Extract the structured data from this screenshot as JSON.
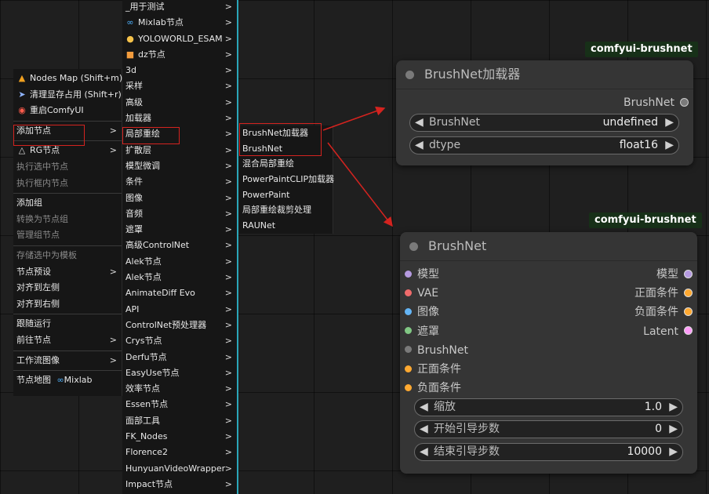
{
  "context_menu": {
    "items": [
      {
        "label": "Nodes Map (Shift+m)",
        "icon": "nodes-map-icon",
        "disabled": false,
        "submenu": false
      },
      {
        "label": "清理显存占用 (Shift+r)",
        "icon": "rocket-icon",
        "disabled": false,
        "submenu": false
      },
      {
        "label": "重启ComfyUI",
        "icon": "restart-icon",
        "disabled": false,
        "submenu": false
      },
      {
        "label": "添加节点",
        "disabled": false,
        "submenu": true
      },
      {
        "label": "RG节点",
        "icon": "rg-icon",
        "disabled": false,
        "submenu": true
      },
      {
        "label": "执行选中节点",
        "disabled": true,
        "submenu": false
      },
      {
        "label": "执行框内节点",
        "disabled": true,
        "submenu": false
      },
      {
        "label": "添加组",
        "disabled": false,
        "submenu": false
      },
      {
        "label": "转换为节点组",
        "disabled": true,
        "submenu": false
      },
      {
        "label": "管理组节点",
        "disabled": true,
        "submenu": false
      },
      {
        "label": "存储选中为模板",
        "disabled": true,
        "submenu": false
      },
      {
        "label": "节点预设",
        "disabled": false,
        "submenu": true
      },
      {
        "label": "对齐到左侧",
        "disabled": false,
        "submenu": false
      },
      {
        "label": "对齐到右侧",
        "disabled": false,
        "submenu": false
      },
      {
        "label": "跟随运行",
        "disabled": false,
        "submenu": false
      },
      {
        "label": "前往节点",
        "disabled": false,
        "submenu": true
      },
      {
        "label": "工作流图像",
        "disabled": false,
        "submenu": true
      },
      {
        "label": "节点地图",
        "suffix": "Mixlab",
        "disabled": false,
        "submenu": false
      }
    ]
  },
  "add_node_menu": {
    "items": [
      "_用于测试",
      "Mixlab节点",
      "YOLOWORLD_ESAM",
      "dz节点",
      "3d",
      "采样",
      "高级",
      "加载器",
      "局部重绘",
      "扩散层",
      "模型微调",
      "条件",
      "图像",
      "音频",
      "遮罩",
      "高级ControlNet",
      "Alek节点",
      "Alek节点",
      "AnimateDiff Evo",
      "API",
      "ControlNet预处理器",
      "Crys节点",
      "Derfu节点",
      "EasyUse节点",
      "效率节点",
      "Essen节点",
      "面部工具",
      "FK_Nodes",
      "Florence2",
      "HunyuanVideoWrapper",
      "Impact节点"
    ]
  },
  "inpaint_menu": {
    "items": [
      "BrushNet加载器",
      "BrushNet",
      "混合局部重绘",
      "PowerPaintCLIP加载器",
      "PowerPaint",
      "局部重绘裁剪处理",
      "RAUNet"
    ]
  },
  "loader_node": {
    "badge": "comfyui-brushnet",
    "title": "BrushNet加载器",
    "output": "BrushNet",
    "widgets": [
      {
        "label": "BrushNet",
        "value": "undefined"
      },
      {
        "label": "dtype",
        "value": "float16"
      }
    ]
  },
  "brushnet_node": {
    "badge": "comfyui-brushnet",
    "title": "BrushNet",
    "inputs": [
      {
        "label": "模型",
        "color": "#b59ae0"
      },
      {
        "label": "VAE",
        "color": "#ef6b6b"
      },
      {
        "label": "图像",
        "color": "#64b5f6"
      },
      {
        "label": "遮罩",
        "color": "#81c784"
      },
      {
        "label": "BrushNet",
        "color": "#7a7a7a"
      },
      {
        "label": "正面条件",
        "color": "#ffa931"
      },
      {
        "label": "负面条件",
        "color": "#ffa931"
      }
    ],
    "outputs": [
      {
        "label": "模型",
        "color": "#b59ae0"
      },
      {
        "label": "正面条件",
        "color": "#ffa931"
      },
      {
        "label": "负面条件",
        "color": "#ffa931"
      },
      {
        "label": "Latent",
        "color": "#ff9cf9"
      }
    ],
    "widgets": [
      {
        "label": "缩放",
        "value": "1.0"
      },
      {
        "label": "开始引导步数",
        "value": "0"
      },
      {
        "label": "结束引导步数",
        "value": "10000"
      }
    ]
  },
  "colors": {
    "highlight": "#d4231f",
    "badge_bg": "#173018",
    "node_bg": "#353535"
  }
}
